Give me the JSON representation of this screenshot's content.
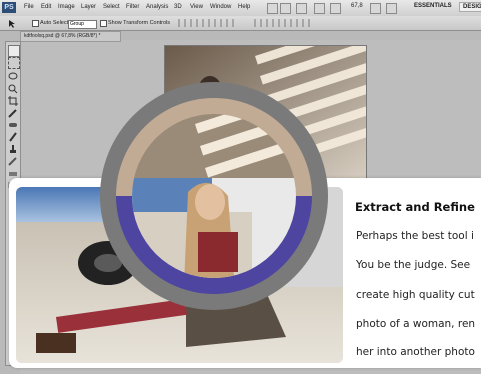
{
  "app": {
    "logo": "PS"
  },
  "menubar": {
    "items": [
      "File",
      "Edit",
      "Image",
      "Layer",
      "Select",
      "Filter",
      "Analysis",
      "3D",
      "View",
      "Window",
      "Help"
    ],
    "zoom": "67,8",
    "workspace_essentials": "ESSENTIALS",
    "workspace_design": "DESIG"
  },
  "options_bar": {
    "auto_select_label": "Auto Select:",
    "auto_select_value": "Group",
    "show_transform_label": "Show Transform Controls"
  },
  "document": {
    "tab_label": "kdtfoolxq.psd @ 67,8% (RGB/8*) *"
  },
  "article": {
    "title": "Extract and Refine",
    "lines": [
      "Perhaps the best tool i",
      "You be the judge. See",
      "create high quality cut",
      "photo of a woman, ren",
      "her into another photo"
    ]
  },
  "colors": {
    "ring_outer": "#7a7a7a",
    "ring_top": "#c2ab94",
    "ring_bottom": "#4d45a0",
    "card_bg": "#ffffff"
  }
}
